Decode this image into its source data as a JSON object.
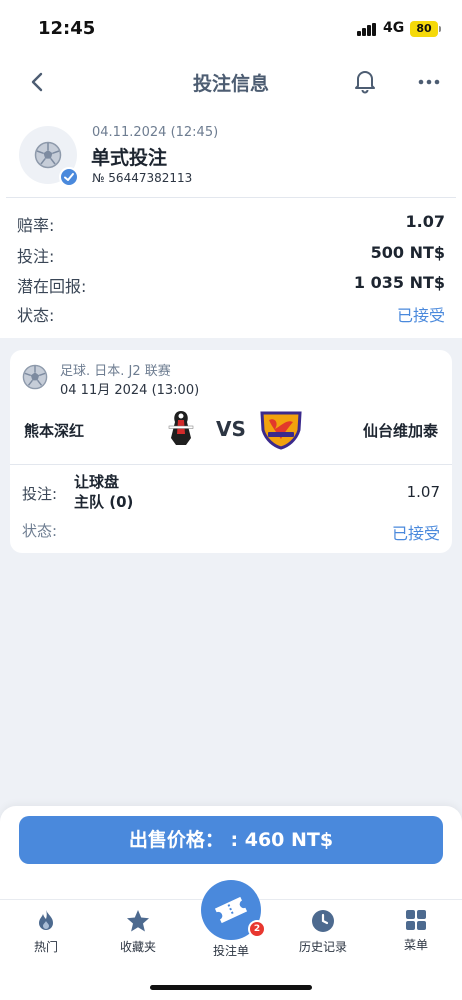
{
  "status_bar": {
    "time": "12:45",
    "network": "4G",
    "battery": "80"
  },
  "nav": {
    "title": "投注信息"
  },
  "bet": {
    "datetime": "04.11.2024 (12:45)",
    "type": "单式投注",
    "number": "№ 56447382113"
  },
  "details": [
    {
      "label": "赔率:",
      "value": "1.07"
    },
    {
      "label": "投注:",
      "value": "500 NT$"
    },
    {
      "label": "潜在回报:",
      "value": "1 035 NT$"
    },
    {
      "label": "状态:",
      "value": "已接受"
    }
  ],
  "match": {
    "league": "足球. 日本. J2 联赛",
    "date": "04 11月 2024 (13:00)",
    "home_team": "熊本深红",
    "vs": "VS",
    "away_team": "仙台维加泰",
    "bet_label": "投注:",
    "market": "让球盘",
    "selection": "主队 (0)",
    "odds": "1.07",
    "status_label": "状态:",
    "status": "已接受"
  },
  "sell_button": "出售价格： : 460 NT$",
  "tabs": {
    "hot": "热门",
    "favorites": "收藏夹",
    "betslip": "投注单",
    "betslip_badge": "2",
    "history": "历史记录",
    "menu": "菜单"
  },
  "colors": {
    "accent": "#4a89dc",
    "badge": "#e8372f",
    "background": "#eef1f6"
  },
  "icons": [
    "back-icon",
    "bell-icon",
    "more-icon",
    "soccer-ball-icon",
    "check-icon",
    "flame-icon",
    "star-icon",
    "ticket-icon",
    "clock-icon",
    "grid-icon"
  ]
}
